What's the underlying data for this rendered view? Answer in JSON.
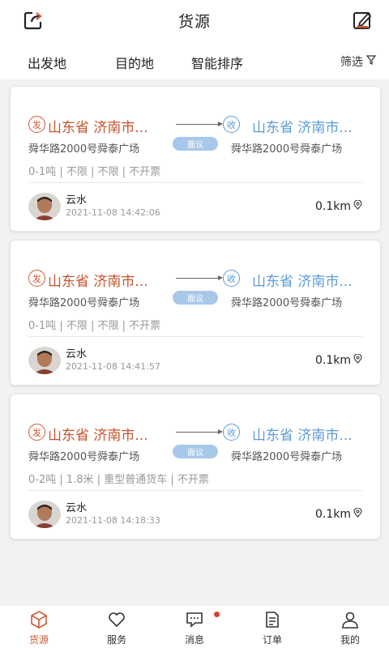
{
  "header": {
    "title": "货源"
  },
  "filters": {
    "origin": "出发地",
    "destination": "目的地",
    "sort": "智能排序",
    "filter": "筛选"
  },
  "colors": {
    "accent": "#d05a33",
    "blue": "#5b9bd5"
  },
  "cards": [
    {
      "origin_badge": "发",
      "origin_city": "山东省 济南市...",
      "dest_badge": "收",
      "dest_city": "山东省 济南市...",
      "origin_addr": "舜华路2000号舜泰广场",
      "dest_addr": "舜华路2000号舜泰广场",
      "price": "面议",
      "specs": "0-1吨 | 不限 | 不限 | 不开票",
      "user": "云水",
      "time": "2021-11-08 14:42:06",
      "distance": "0.1km"
    },
    {
      "origin_badge": "发",
      "origin_city": "山东省 济南市...",
      "dest_badge": "收",
      "dest_city": "山东省 济南市...",
      "origin_addr": "舜华路2000号舜泰广场",
      "dest_addr": "舜华路2000号舜泰广场",
      "price": "面议",
      "specs": "0-1吨 | 不限 | 不限 | 不开票",
      "user": "云水",
      "time": "2021-11-08 14:41:57",
      "distance": "0.1km"
    },
    {
      "origin_badge": "发",
      "origin_city": "山东省 济南市...",
      "dest_badge": "收",
      "dest_city": "山东省 济南市...",
      "origin_addr": "舜华路2000号舜泰广场",
      "dest_addr": "舜华路2000号舜泰广场",
      "price": "面议",
      "specs": "0-2吨 | 1.8米 | 重型普通货车 | 不开票",
      "user": "云水",
      "time": "2021-11-08 14:18:33",
      "distance": "0.1km"
    }
  ],
  "tabs": [
    {
      "label": "货源",
      "icon": "cube-icon",
      "active": true
    },
    {
      "label": "服务",
      "icon": "heart-icon",
      "active": false
    },
    {
      "label": "消息",
      "icon": "message-icon",
      "active": false
    },
    {
      "label": "订单",
      "icon": "document-icon",
      "active": false
    },
    {
      "label": "我的",
      "icon": "user-icon",
      "active": false
    }
  ]
}
